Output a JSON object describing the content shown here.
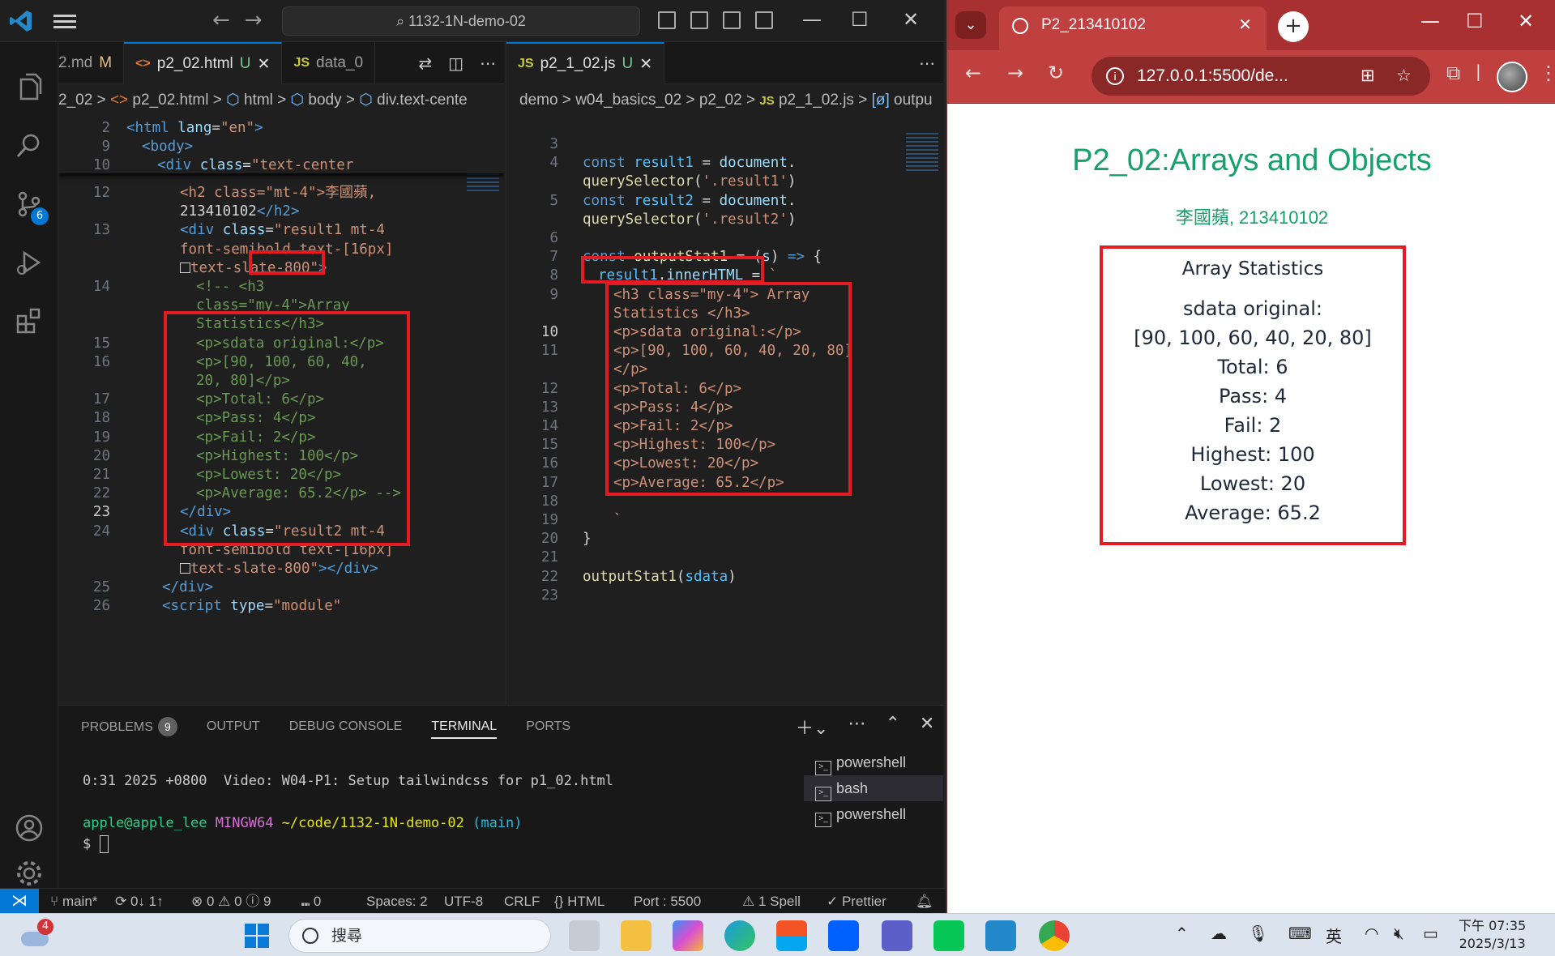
{
  "vscode": {
    "command_center": "1132-1N-demo-02",
    "group1": {
      "tabs": [
        {
          "label": "2.md",
          "status": "M",
          "icon": "md-icon"
        },
        {
          "label": "p2_02.html",
          "status": "U",
          "icon": "html-icon",
          "active": true
        },
        {
          "label": "data_0",
          "status": "",
          "icon": "js-icon"
        }
      ],
      "breadcrumb": [
        "2_02",
        "p2_02.html",
        "html",
        "body",
        "div.text-cente"
      ],
      "lines": [
        {
          "n": "2",
          "html": "<span class='tag'>&lt;html</span> <span class='attr'>lang</span>=<span class='str'>\"en\"</span><span class='tag'>&gt;</span>",
          "ind": 0
        },
        {
          "n": "9",
          "html": "<span class='tag'>&lt;body&gt;</span>",
          "ind": 1
        },
        {
          "n": "10",
          "html": "<span class='tag'>&lt;div</span> <span class='attr'>class</span>=<span class='str'>\"text-center</span>",
          "ind": 2
        }
      ]
    },
    "group2": {
      "tabs": [
        {
          "label": "p2_1_02.js",
          "status": "U",
          "icon": "js-icon",
          "active": true
        }
      ],
      "breadcrumb": [
        "demo",
        "w04_basics_02",
        "p2_02",
        "p2_1_02.js",
        "outpu"
      ]
    },
    "panel": {
      "tabs": [
        "PROBLEMS",
        "OUTPUT",
        "DEBUG CONSOLE",
        "TERMINAL",
        "PORTS"
      ],
      "problems_count": "9",
      "terminal_line1": "0:31 2025 +0800  Video: W04-P1: Setup tailwindcss for p1_02.html",
      "prompt_user": "apple@apple_lee",
      "prompt_env": "MINGW64",
      "prompt_path": "~/code/1132-1N-demo-02",
      "prompt_branch": "(main)",
      "prompt_symbol": "$",
      "terminals": [
        "powershell",
        "bash",
        "powershell"
      ]
    },
    "status": {
      "branch": "main*",
      "sync": "0↓ 1↑",
      "problems": "⊗ 0 ⚠ 0 ⓘ 9",
      "ports": "⑉ 0",
      "spaces": "Spaces: 2",
      "encoding": "UTF-8",
      "eol": "CRLF",
      "language": "{} HTML",
      "port": "Port : 5500",
      "spell": "⚠ 1 Spell",
      "prettier": "✓ Prettier"
    },
    "scm_badge": "6"
  },
  "browser": {
    "tab_title": "P2_213410102",
    "url": "127.0.0.1:5500/de...",
    "page": {
      "heading": "P2_02:Arrays and Objects",
      "subheading": "李國蘋, 213410102",
      "box_title": "Array Statistics",
      "lines": [
        "sdata original:",
        "[90, 100, 60, 40, 20, 80]",
        "Total: 6",
        "Pass: 4",
        "Fail: 2",
        "Highest: 100",
        "Lowest: 20",
        "Average: 65.2"
      ]
    }
  },
  "taskbar": {
    "search_placeholder": "搜尋",
    "notification_badge": "4",
    "ime": "英",
    "time": "下午 07:35",
    "date": "2025/3/13"
  },
  "colors": {
    "accent": "#0078d4",
    "highlight_box": "#e51b24",
    "heading_green": "#16a06a",
    "browser_frame": "#c04040"
  }
}
